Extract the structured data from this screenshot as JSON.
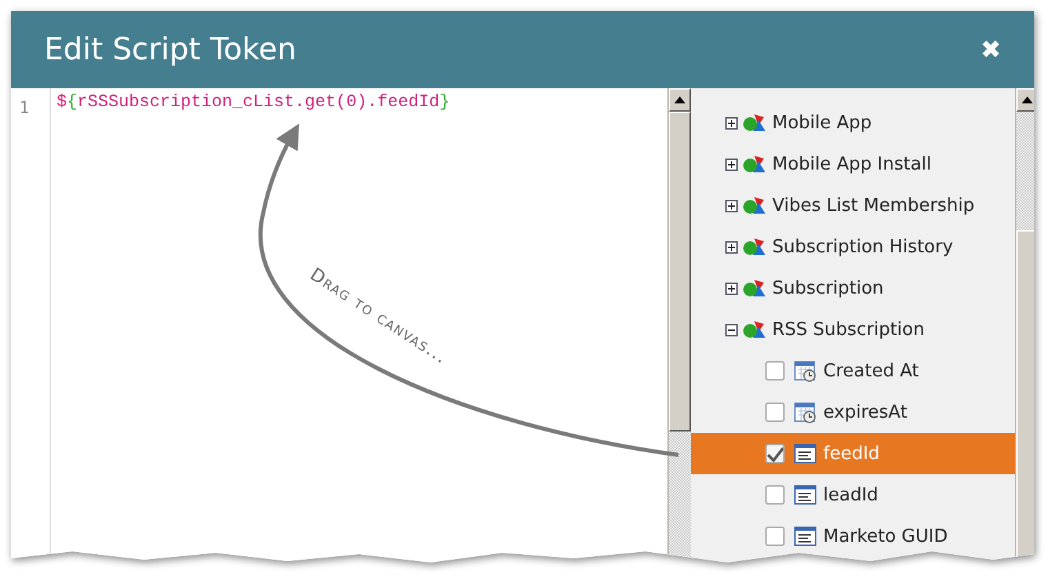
{
  "window": {
    "title": "Edit Script Token",
    "close": "✖"
  },
  "editor": {
    "line_number": "1",
    "tokens": [
      {
        "text": "$",
        "kind": "sigil"
      },
      {
        "text": "{",
        "kind": "brace"
      },
      {
        "text": "rSSSubscription_cList.get(0).feedId",
        "kind": "ident"
      },
      {
        "text": "}",
        "kind": "brace"
      }
    ]
  },
  "annotation": {
    "text": "Drag to canvas..."
  },
  "tree": {
    "items": [
      {
        "kind": "object",
        "label": "Mobile App",
        "expanded": false
      },
      {
        "kind": "object",
        "label": "Mobile App Install",
        "expanded": false
      },
      {
        "kind": "object",
        "label": "Vibes List Membership",
        "expanded": false
      },
      {
        "kind": "object",
        "label": "Subscription History",
        "expanded": false
      },
      {
        "kind": "object",
        "label": "Subscription",
        "expanded": false
      },
      {
        "kind": "object",
        "label": "RSS Subscription",
        "expanded": true,
        "children": [
          {
            "kind": "date",
            "label": "Created At",
            "checked": false,
            "selected": false
          },
          {
            "kind": "date",
            "label": "expiresAt",
            "checked": false,
            "selected": false
          },
          {
            "kind": "text",
            "label": "feedId",
            "checked": true,
            "selected": true
          },
          {
            "kind": "text",
            "label": "leadId",
            "checked": false,
            "selected": false
          },
          {
            "kind": "text",
            "label": "Marketo GUID",
            "checked": false,
            "selected": false
          }
        ]
      }
    ]
  }
}
